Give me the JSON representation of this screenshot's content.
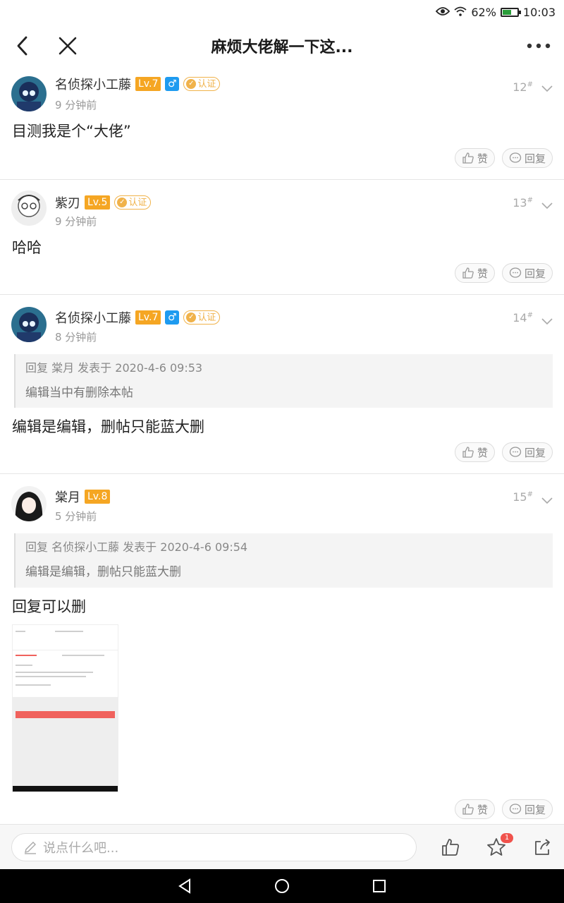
{
  "status_bar": {
    "battery_percent": "62%",
    "battery_level": 0.62,
    "time": "10:03"
  },
  "nav": {
    "title": "麻烦大佬解一下这..."
  },
  "posts": [
    {
      "username": "名侦探小工藤",
      "level": "Lv.7",
      "gender": "♂",
      "verified": "认证",
      "time": "9 分钟前",
      "floor": "12",
      "floor_sup": "#",
      "text": "目测我是个“大佬”",
      "like": "赞",
      "reply": "回复"
    },
    {
      "username": "紫刃",
      "level": "Lv.5",
      "verified": "认证",
      "time": "9 分钟前",
      "floor": "13",
      "floor_sup": "#",
      "text": "哈哈",
      "like": "赞",
      "reply": "回复"
    },
    {
      "username": "名侦探小工藤",
      "level": "Lv.7",
      "gender": "♂",
      "verified": "认证",
      "time": "8 分钟前",
      "floor": "14",
      "floor_sup": "#",
      "quote_head": "回复 棠月 发表于 2020-4-6 09:53",
      "quote_body": "编辑当中有删除本帖",
      "text": "编辑是编辑，删帖只能蓝大删",
      "like": "赞",
      "reply": "回复"
    },
    {
      "username": "棠月",
      "level": "Lv.8",
      "time": "5 分钟前",
      "floor": "15",
      "floor_sup": "#",
      "quote_head": "回复 名侦探小工藤 发表于 2020-4-6 09:54",
      "quote_body": "编辑是编辑，删帖只能蓝大删",
      "text": "回复可以删",
      "like": "赞",
      "reply": "回复"
    }
  ],
  "input_bar": {
    "placeholder": "说点什么吧...",
    "star_badge": "1"
  },
  "colors": {
    "level_badge": "#f5a623",
    "gender_badge": "#1e9bf0",
    "verify": "#f0b24a",
    "badge_red": "#f0524c"
  }
}
